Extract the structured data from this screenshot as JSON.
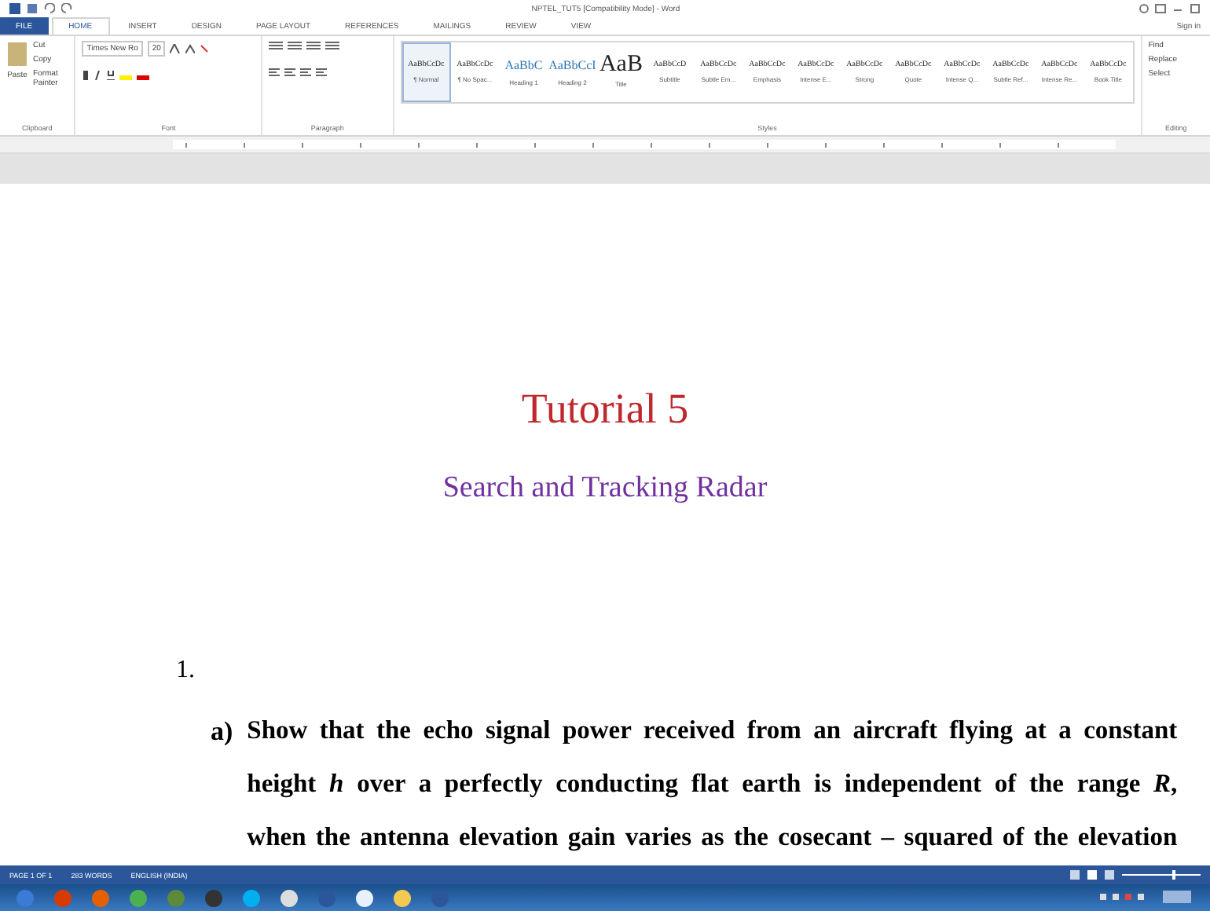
{
  "window": {
    "title": "NPTEL_TUT5 [Compatibility Mode] - Word"
  },
  "tabs": [
    {
      "label": "FILE",
      "kind": "file",
      "selected": false
    },
    {
      "label": "HOME",
      "kind": "tab",
      "selected": true
    },
    {
      "label": "INSERT",
      "kind": "tab",
      "selected": false
    },
    {
      "label": "DESIGN",
      "kind": "tab",
      "selected": false
    },
    {
      "label": "PAGE LAYOUT",
      "kind": "tab",
      "selected": false
    },
    {
      "label": "REFERENCES",
      "kind": "tab",
      "selected": false
    },
    {
      "label": "MAILINGS",
      "kind": "tab",
      "selected": false
    },
    {
      "label": "REVIEW",
      "kind": "tab",
      "selected": false
    },
    {
      "label": "VIEW",
      "kind": "tab",
      "selected": false
    }
  ],
  "account": {
    "label": "Sign in"
  },
  "ribbon": {
    "clipboard": {
      "paste": "Paste",
      "items": [
        "Cut",
        "Copy",
        "Format Painter"
      ],
      "label": "Clipboard"
    },
    "font": {
      "name": "Times New Ro",
      "size": "20",
      "label": "Font"
    },
    "paragraph": {
      "label": "Paragraph"
    },
    "styles": {
      "label": "Styles",
      "items": [
        {
          "preview": "AaBbCcDc",
          "name": "¶ Normal",
          "kind": "small",
          "selected": true
        },
        {
          "preview": "AaBbCcDc",
          "name": "¶ No Spac...",
          "kind": "small",
          "selected": false
        },
        {
          "preview": "AaBbC",
          "name": "Heading 1",
          "kind": "heading",
          "selected": false
        },
        {
          "preview": "AaBbCcI",
          "name": "Heading 2",
          "kind": "heading",
          "selected": false
        },
        {
          "preview": "AaB",
          "name": "Title",
          "kind": "title",
          "selected": false
        },
        {
          "preview": "AaBbCcD",
          "name": "Subtitle",
          "kind": "small",
          "selected": false
        },
        {
          "preview": "AaBbCcDc",
          "name": "Subtle Em...",
          "kind": "small",
          "selected": false
        },
        {
          "preview": "AaBbCcDc",
          "name": "Emphasis",
          "kind": "small",
          "selected": false
        },
        {
          "preview": "AaBbCcDc",
          "name": "Intense E...",
          "kind": "small",
          "selected": false
        },
        {
          "preview": "AaBbCcDc",
          "name": "Strong",
          "kind": "small",
          "selected": false
        },
        {
          "preview": "AaBbCcDc",
          "name": "Quote",
          "kind": "small",
          "selected": false
        },
        {
          "preview": "AaBbCcDc",
          "name": "Intense Q...",
          "kind": "small",
          "selected": false
        },
        {
          "preview": "AaBbCcDc",
          "name": "Subtle Ref...",
          "kind": "small",
          "selected": false
        },
        {
          "preview": "AaBbCcDc",
          "name": "Intense Re...",
          "kind": "small",
          "selected": false
        },
        {
          "preview": "AaBbCcDc",
          "name": "Book Title",
          "kind": "small",
          "selected": false
        }
      ]
    },
    "editing": {
      "label": "Editing",
      "items": [
        "Find",
        "Replace",
        "Select"
      ]
    }
  },
  "document": {
    "title": "Tutorial 5",
    "subtitle": "Search and Tracking Radar",
    "number": "1.",
    "item_label": "a)",
    "item_lines": [
      "Show that the echo signal power received from an aircraft flying at a constant",
      "height *h* over a perfectly conducting flat earth is independent of the range *R*,",
      "when the antenna elevation gain varies as the cosecant – squared of the elevation"
    ]
  },
  "status_bar": {
    "page": "PAGE 1 OF 1",
    "words": "283 WORDS",
    "language": "ENGLISH (INDIA)"
  }
}
